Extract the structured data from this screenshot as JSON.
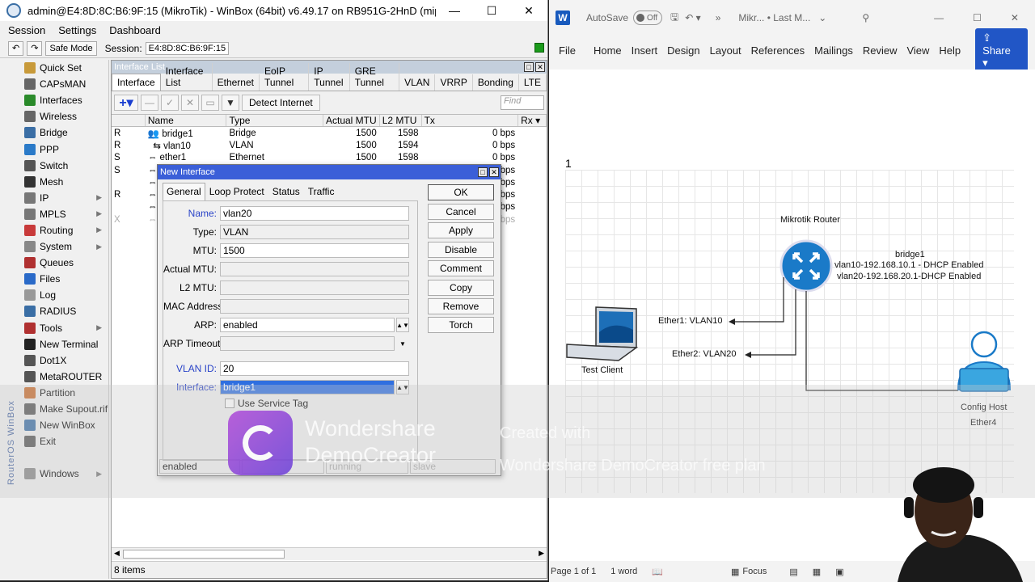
{
  "winbox": {
    "title": "admin@E4:8D:8C:B6:9F:15 (MikroTik) - WinBox (64bit) v6.49.17 on RB951G-2HnD (mipsbe)",
    "menu": [
      "Session",
      "Settings",
      "Dashboard"
    ],
    "safe_mode": "Safe Mode",
    "session_label": "Session:",
    "session_value": "E4:8D:8C:B6:9F:15",
    "brand": "RouterOS WinBox",
    "sidebar": [
      {
        "label": "Quick Set",
        "icon": "quick-set-icon",
        "color": "#c89a3a",
        "sub": false
      },
      {
        "label": "CAPsMAN",
        "icon": "capsman-icon",
        "color": "#666",
        "sub": false
      },
      {
        "label": "Interfaces",
        "icon": "interfaces-icon",
        "color": "#2a8a2a",
        "sub": false
      },
      {
        "label": "Wireless",
        "icon": "wireless-icon",
        "color": "#666",
        "sub": false
      },
      {
        "label": "Bridge",
        "icon": "bridge-icon",
        "color": "#3a6ea5",
        "sub": false
      },
      {
        "label": "PPP",
        "icon": "ppp-icon",
        "color": "#2a7ac8",
        "sub": false
      },
      {
        "label": "Switch",
        "icon": "switch-icon",
        "color": "#555",
        "sub": false
      },
      {
        "label": "Mesh",
        "icon": "mesh-icon",
        "color": "#333",
        "sub": false
      },
      {
        "label": "IP",
        "icon": "ip-icon",
        "color": "#777",
        "sub": true
      },
      {
        "label": "MPLS",
        "icon": "mpls-icon",
        "color": "#777",
        "sub": true
      },
      {
        "label": "Routing",
        "icon": "routing-icon",
        "color": "#c83a3a",
        "sub": true
      },
      {
        "label": "System",
        "icon": "system-icon",
        "color": "#888",
        "sub": true
      },
      {
        "label": "Queues",
        "icon": "queues-icon",
        "color": "#b03030",
        "sub": false
      },
      {
        "label": "Files",
        "icon": "files-icon",
        "color": "#2a6ac8",
        "sub": false
      },
      {
        "label": "Log",
        "icon": "log-icon",
        "color": "#999",
        "sub": false
      },
      {
        "label": "RADIUS",
        "icon": "radius-icon",
        "color": "#3a6ea5",
        "sub": false
      },
      {
        "label": "Tools",
        "icon": "tools-icon",
        "color": "#b03030",
        "sub": true
      },
      {
        "label": "New Terminal",
        "icon": "terminal-icon",
        "color": "#222",
        "sub": false
      },
      {
        "label": "Dot1X",
        "icon": "dot1x-icon",
        "color": "#555",
        "sub": false
      },
      {
        "label": "MetaROUTER",
        "icon": "metarouter-icon",
        "color": "#555",
        "sub": false
      },
      {
        "label": "Partition",
        "icon": "partition-icon",
        "color": "#c86a2a",
        "sub": false
      },
      {
        "label": "Make Supout.rif",
        "icon": "supout-icon",
        "color": "#555",
        "sub": false
      },
      {
        "label": "New WinBox",
        "icon": "new-winbox-icon",
        "color": "#3a6ea5",
        "sub": false
      },
      {
        "label": "Exit",
        "icon": "exit-icon",
        "color": "#555",
        "sub": false
      },
      {
        "label": "",
        "icon": "",
        "color": "#f0f0f0",
        "sub": false
      },
      {
        "label": "Windows",
        "icon": "windows-icon",
        "color": "#888",
        "sub": true
      }
    ]
  },
  "interface_list": {
    "title": "Interface List",
    "tabs": [
      "Interface",
      "Interface List",
      "Ethernet",
      "EoIP Tunnel",
      "IP Tunnel",
      "GRE Tunnel",
      "VLAN",
      "VRRP",
      "Bonding",
      "LTE"
    ],
    "detect_internet": "Detect Internet",
    "find_placeholder": "Find",
    "columns": [
      "",
      "Name",
      "Type",
      "Actual MTU",
      "L2 MTU",
      "Tx",
      "Rx"
    ],
    "rows": [
      {
        "flag": "R",
        "name": "bridge1",
        "type": "Bridge",
        "mtu": "1500",
        "l2mtu": "1598",
        "tx": "0 bps"
      },
      {
        "flag": "R",
        "name": "vlan10",
        "type": "VLAN",
        "mtu": "1500",
        "l2mtu": "1594",
        "tx": "0 bps"
      },
      {
        "flag": "S",
        "name": "ether1",
        "type": "Ethernet",
        "mtu": "1500",
        "l2mtu": "1598",
        "tx": "0 bps"
      },
      {
        "flag": "S",
        "name": "",
        "type": "",
        "mtu": "",
        "l2mtu": "",
        "tx": "bps"
      },
      {
        "flag": "",
        "name": "",
        "type": "",
        "mtu": "",
        "l2mtu": "",
        "tx": "bps"
      },
      {
        "flag": "R",
        "name": "",
        "type": "",
        "mtu": "",
        "l2mtu": "",
        "tx": "kbps"
      },
      {
        "flag": "",
        "name": "",
        "type": "",
        "mtu": "",
        "l2mtu": "",
        "tx": "bps"
      },
      {
        "flag": "X",
        "name": "",
        "type": "",
        "mtu": "",
        "l2mtu": "",
        "tx": "bps"
      }
    ],
    "status": "8 items"
  },
  "dialog": {
    "title": "New Interface",
    "tabs": [
      "General",
      "Loop Protect",
      "Status",
      "Traffic"
    ],
    "name_label": "Name:",
    "name": "vlan20",
    "type_label": "Type:",
    "type": "VLAN",
    "mtu_label": "MTU:",
    "mtu": "1500",
    "actual_mtu_label": "Actual MTU:",
    "l2mtu_label": "L2 MTU:",
    "mac_label": "MAC Address:",
    "arp_label": "ARP:",
    "arp": "enabled",
    "arp_timeout_label": "ARP Timeout:",
    "vlan_id_label": "VLAN ID:",
    "vlan_id": "20",
    "interface_label": "Interface:",
    "interface": "bridge1",
    "use_service_tag": "Use Service Tag",
    "buttons": [
      "OK",
      "Cancel",
      "Apply",
      "Disable",
      "Comment",
      "Copy",
      "Remove",
      "Torch"
    ],
    "status": [
      "enabled",
      "",
      "running",
      "slave"
    ]
  },
  "word": {
    "autosave": "AutoSave",
    "toggle": "Off",
    "doc_title": "Mikr... • Last M...",
    "ribbon": [
      "File",
      "Home",
      "Insert",
      "Design",
      "Layout",
      "References",
      "Mailings",
      "Review",
      "View",
      "Help"
    ],
    "share": "Share",
    "page_marker": "1",
    "diagram": {
      "router_label": "Mikrotik Router",
      "bridge_label": "bridge1",
      "vlan10_text": "vlan10-192.168.10.1 - DHCP Enabled",
      "vlan20_text": "vlan20-192.168.20.1-DHCP Enabled",
      "ether1": "Ether1: VLAN10",
      "ether2": "Ether2: VLAN20",
      "test_client": "Test Client",
      "config_host": "Config Host",
      "ether4": "Ether4"
    },
    "status": {
      "page": "Page 1 of 1",
      "words": "1 word",
      "focus": "Focus"
    }
  },
  "watermark": {
    "line1": "Wondershare",
    "line2": "DemoCreator",
    "created1": "Created with",
    "created2": "Wondershare DemoCreator free plan"
  },
  "colors": {
    "accent": "#3b5fd8",
    "word_blue": "#2156c6",
    "router_blue": "#1a7ac8"
  }
}
